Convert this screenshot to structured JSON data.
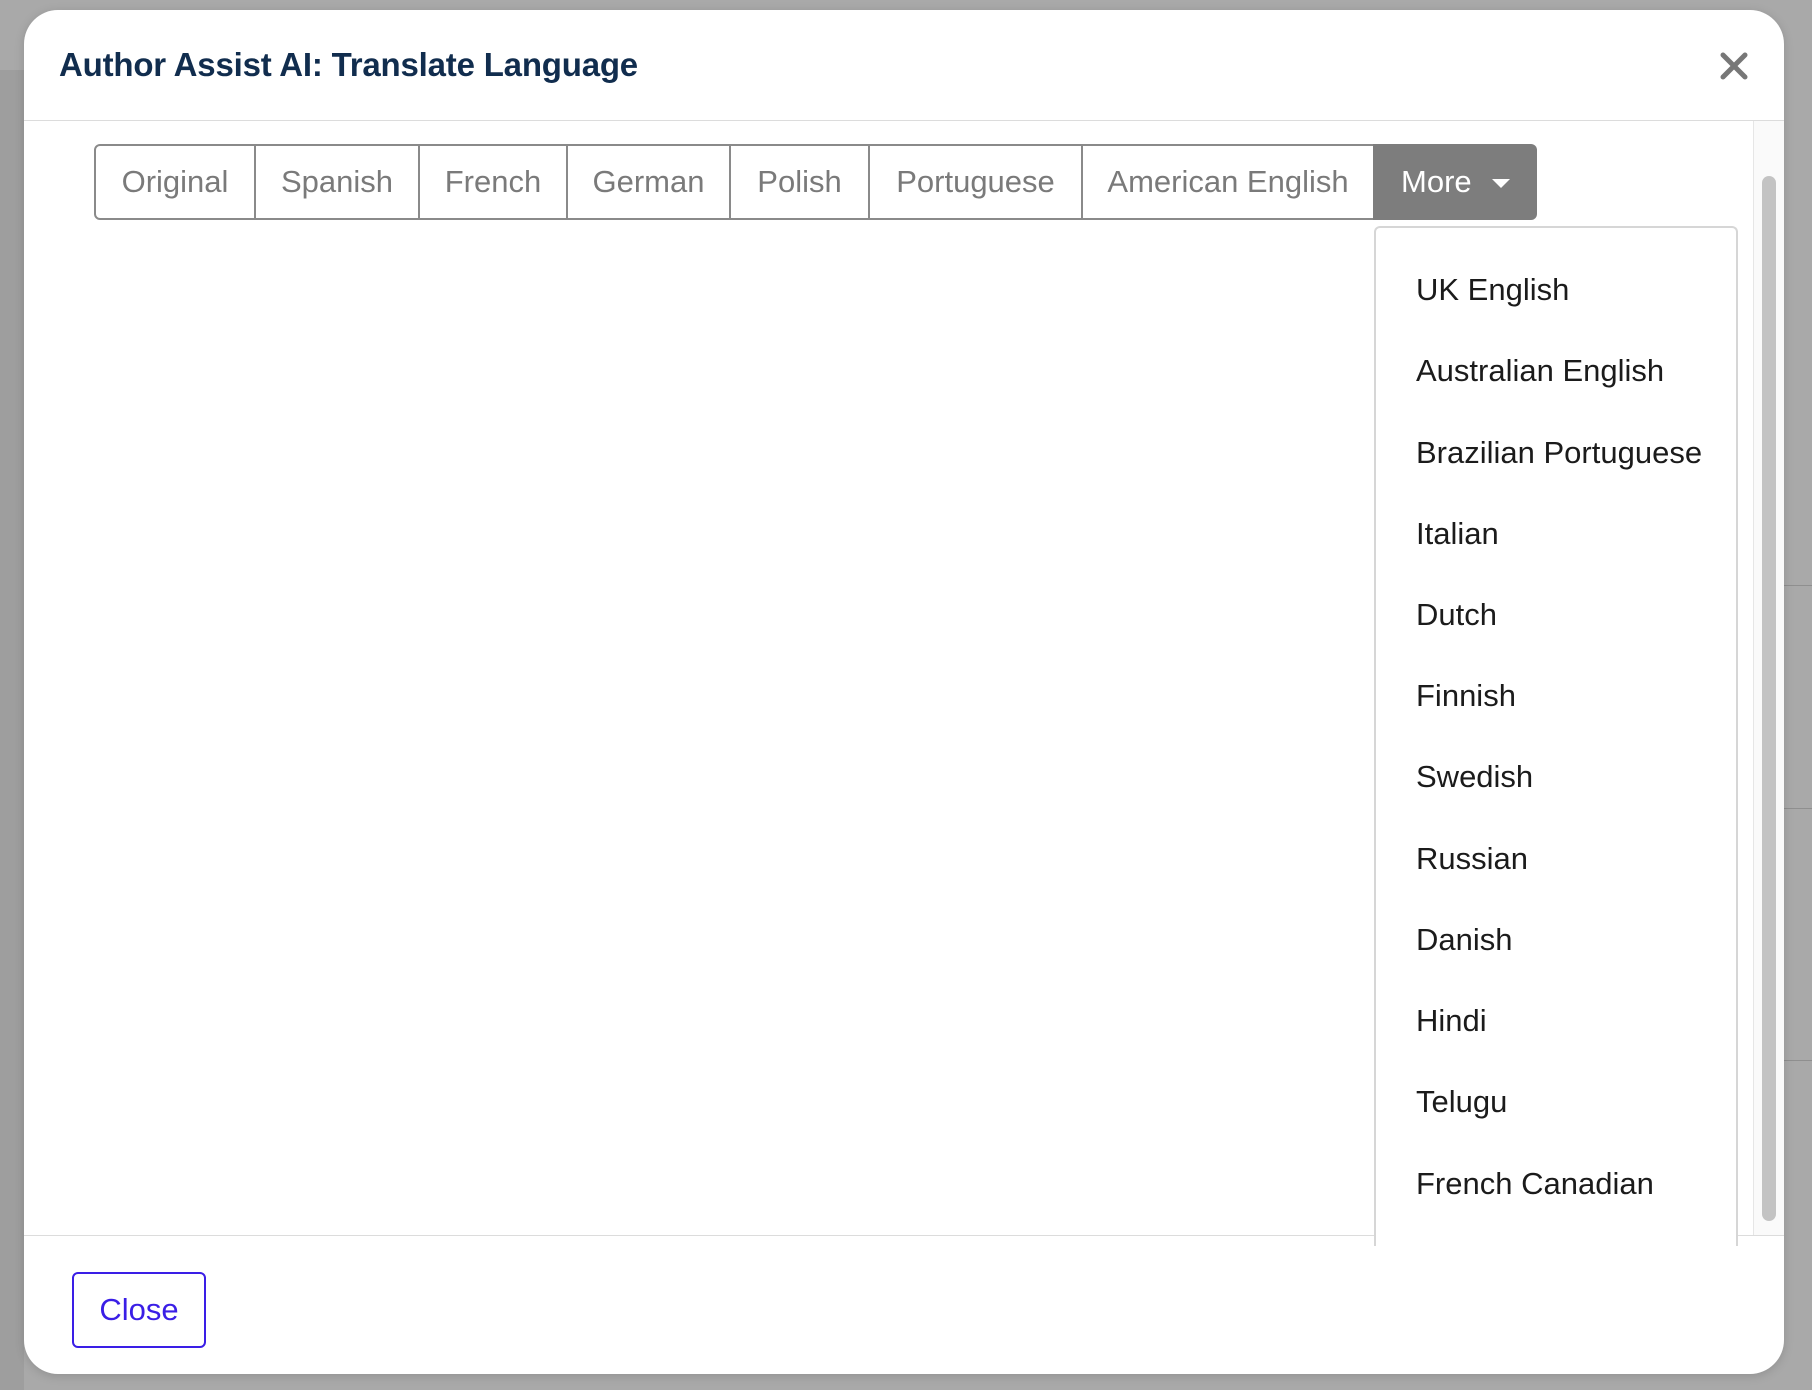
{
  "modal": {
    "title": "Author Assist AI: Translate Language",
    "close_icon": "close-icon",
    "tabs": [
      "Original",
      "Spanish",
      "French",
      "German",
      "Polish",
      "Portuguese",
      "American English"
    ],
    "more_label": "More",
    "more_icon": "caret-down-icon",
    "more_options": [
      "UK English",
      "Australian English",
      "Brazilian Portuguese",
      "Italian",
      "Dutch",
      "Finnish",
      "Swedish",
      "Russian",
      "Danish",
      "Hindi",
      "Telugu",
      "French Canadian"
    ],
    "footer": {
      "close_label": "Close"
    }
  },
  "colors": {
    "title": "#112d4e",
    "tab_border": "#8a8a8a",
    "tab_text": "#7a7a7a",
    "more_bg": "#7d7d7d",
    "accent": "#3a1ee6",
    "backdrop": "#a9a9a9"
  }
}
